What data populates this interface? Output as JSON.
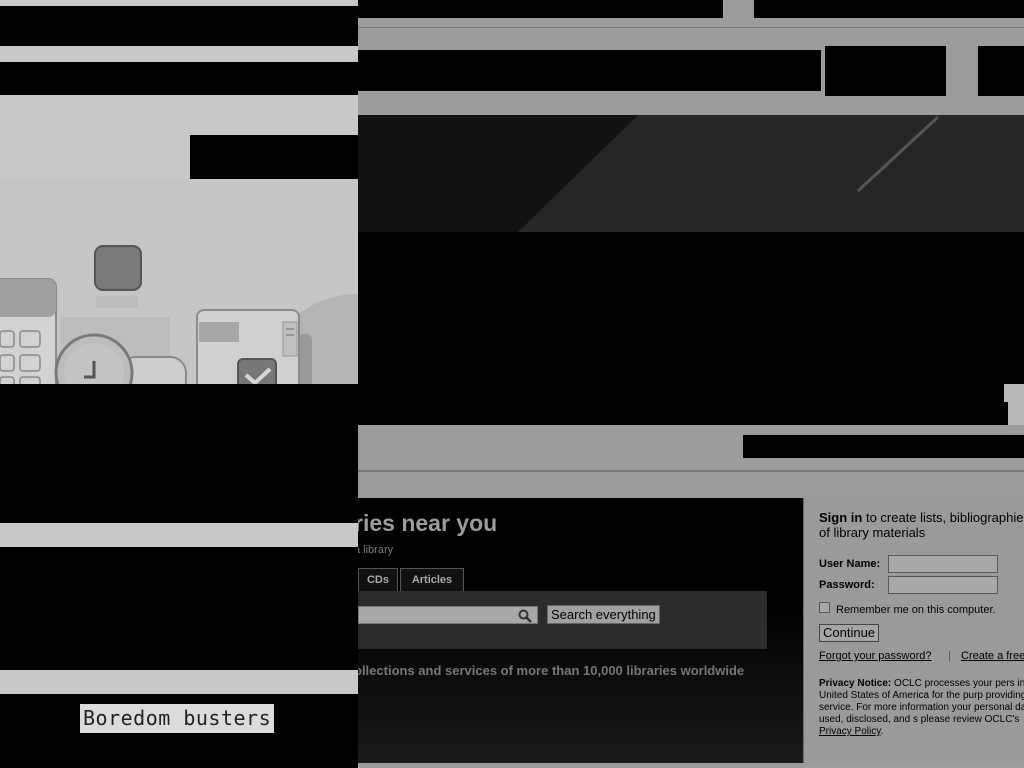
{
  "search": {
    "title": "ries near you",
    "subtitle": "a library",
    "tabs": [
      "CDs",
      "Articles"
    ],
    "button_label": "Search everything",
    "tagline": "ollections and services of more than 10,000 libraries worldwide",
    "search_icon": "search-icon"
  },
  "signin": {
    "heading_bold": "Sign in",
    "heading_rest": " to create lists, bibliographie reviews of library materials",
    "username_label": "User Name:",
    "password_label": "Password:",
    "remember_label": "Remember me on this computer.",
    "continue_label": "Continue",
    "forgot_link": "Forgot your password?",
    "separator": "|",
    "create_link": "Create a free",
    "privacy_bold": "Privacy Notice:",
    "privacy_text": " OCLC processes your pers in the United States of America for the purp providing this service. For more information your personal data is used, disclosed, and s please review OCLC's ",
    "privacy_link": "Privacy Policy",
    "privacy_end": "."
  },
  "left": {
    "card_caption": "Boredom busters",
    "illustration_icons": [
      "calculator-icon",
      "clock-icon",
      "window-icon",
      "checkbox-icon"
    ]
  }
}
